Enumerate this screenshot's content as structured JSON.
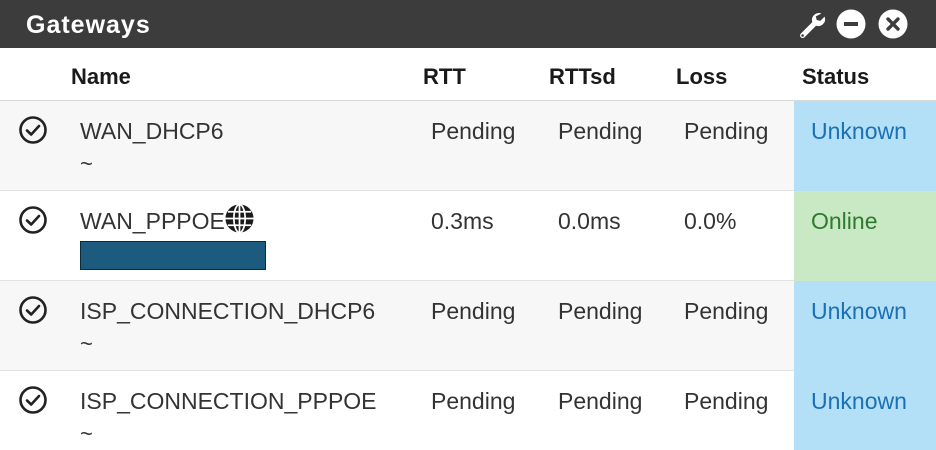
{
  "widget": {
    "title": "Gateways",
    "header_icons": [
      "wrench-icon",
      "minimize-icon",
      "close-icon"
    ]
  },
  "columns": {
    "name": "Name",
    "rtt": "RTT",
    "rttsd": "RTTsd",
    "loss": "Loss",
    "status": "Status"
  },
  "rows": [
    {
      "name": "WAN_DHCP6",
      "sub": "~",
      "rtt": "Pending",
      "rttsd": "Pending",
      "loss": "Pending",
      "status": "Unknown"
    },
    {
      "name": "WAN_PPPOE",
      "sub": "",
      "rtt": "0.3ms",
      "rttsd": "0.0ms",
      "loss": "0.0%",
      "status": "Online",
      "name_icon": "globe-icon"
    },
    {
      "name": "ISP_CONNECTION_DHCP6",
      "sub": "~",
      "rtt": "Pending",
      "rttsd": "Pending",
      "loss": "Pending",
      "status": "Unknown"
    },
    {
      "name": "ISP_CONNECTION_PPPOE",
      "sub": "~",
      "rtt": "Pending",
      "rttsd": "Pending",
      "loss": "Pending",
      "status": "Unknown"
    }
  ],
  "colors": {
    "header_bg": "#3c3c3c",
    "status_unknown_bg": "#b3e0f7",
    "status_online_bg": "#c9e8c4",
    "redaction": "#1c5b7e"
  }
}
